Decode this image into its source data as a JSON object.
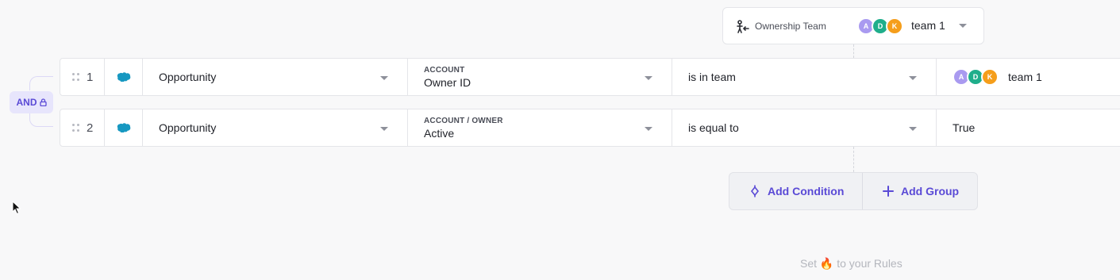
{
  "ownership": {
    "label": "Ownership Team",
    "team_name": "team 1",
    "avatars": [
      {
        "initial": "A",
        "color": "#a99af0"
      },
      {
        "initial": "D",
        "color": "#1fae8b"
      },
      {
        "initial": "K",
        "color": "#f59e1b"
      }
    ]
  },
  "logic": {
    "operator": "AND"
  },
  "rows": [
    {
      "index": "1",
      "source_icon": "salesforce-cloud-icon",
      "object": "Opportunity",
      "field_path": "ACCOUNT",
      "field_name": "Owner ID",
      "operator": "is in team",
      "value": "team 1",
      "value_avatars": [
        {
          "initial": "A",
          "color": "#a99af0"
        },
        {
          "initial": "D",
          "color": "#1fae8b"
        },
        {
          "initial": "K",
          "color": "#f59e1b"
        }
      ]
    },
    {
      "index": "2",
      "source_icon": "salesforce-cloud-icon",
      "object": "Opportunity",
      "field_path": "ACCOUNT / OWNER",
      "field_name": "Active",
      "operator": "is equal to",
      "value": "True"
    }
  ],
  "actions": {
    "add_condition": "Add Condition",
    "add_group": "Add Group"
  },
  "footer": {
    "text_before": "Set",
    "emoji": "🔥",
    "text_after": "to your Rules"
  },
  "colors": {
    "accent": "#5a4ad6",
    "salesforce": "#1798c1"
  }
}
